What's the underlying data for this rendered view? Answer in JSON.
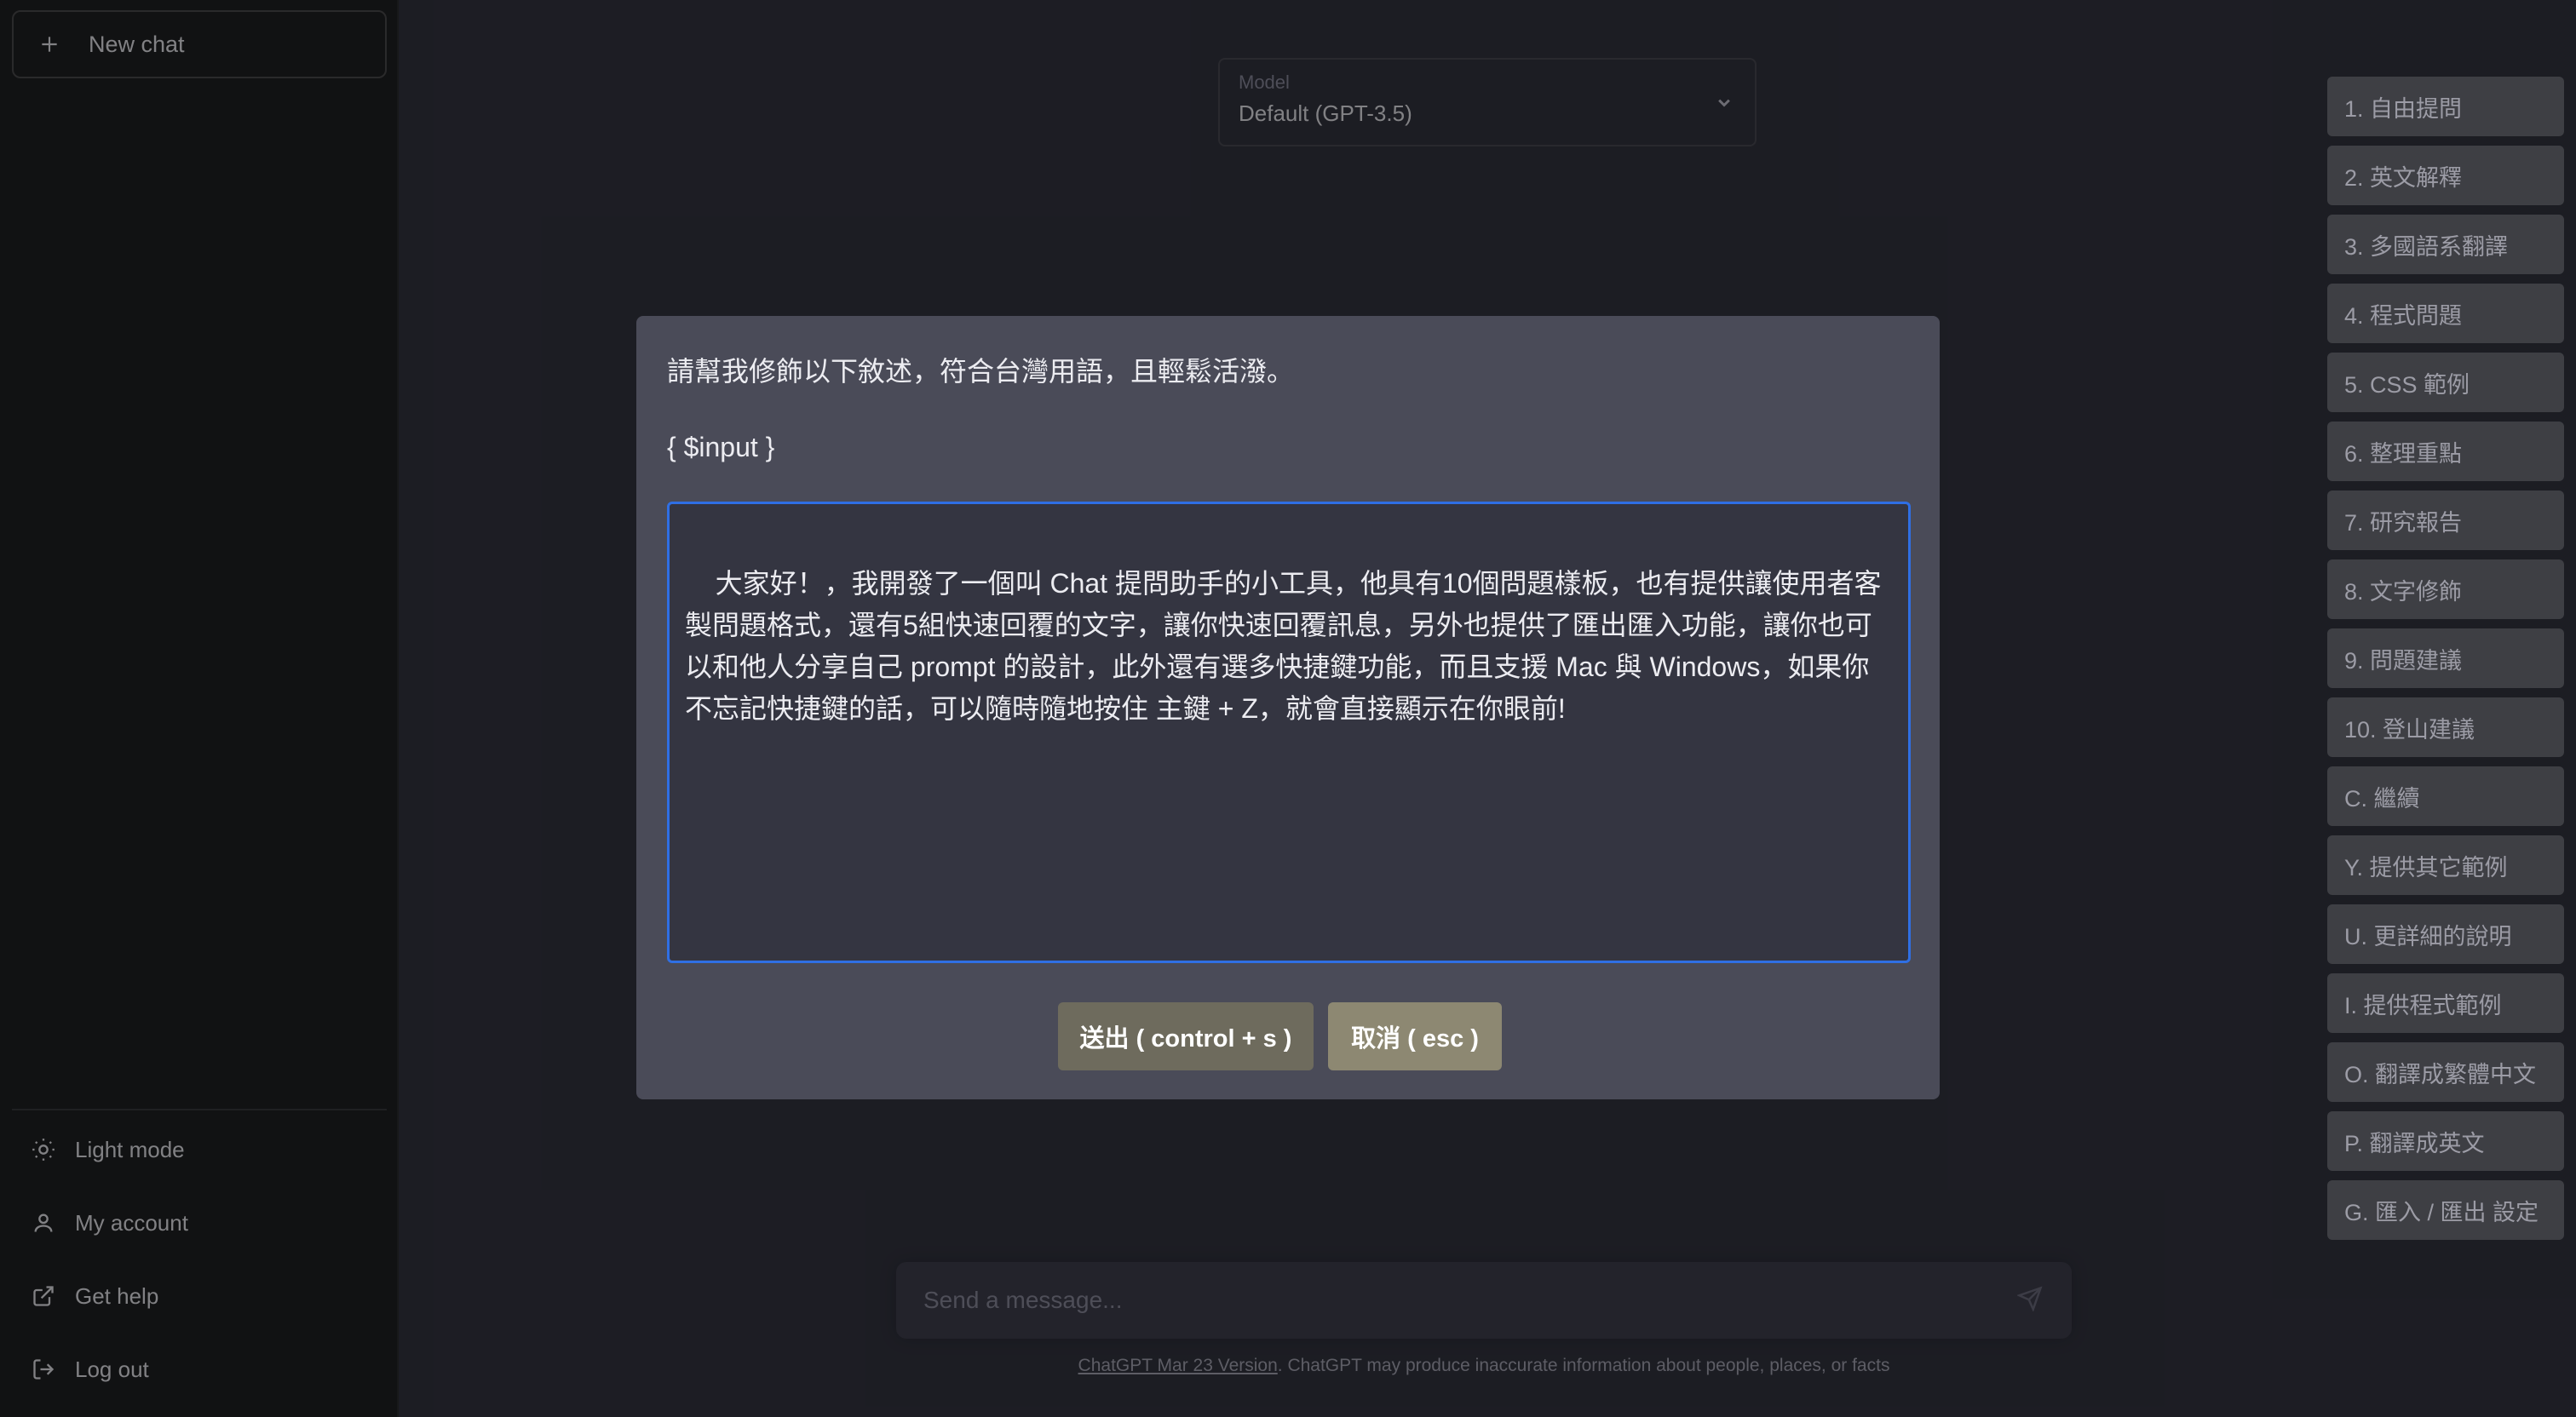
{
  "sidebar": {
    "new_chat_label": "New chat",
    "bottom_items": [
      {
        "label": "Light mode",
        "icon": "sun-icon"
      },
      {
        "label": "My account",
        "icon": "user-icon"
      },
      {
        "label": "Get help",
        "icon": "external-link-icon"
      },
      {
        "label": "Log out",
        "icon": "logout-icon"
      }
    ]
  },
  "model_selector": {
    "label": "Model",
    "value": "Default (GPT-3.5)"
  },
  "composer": {
    "placeholder": "Send a message..."
  },
  "footer": {
    "link_text": "ChatGPT Mar 23 Version",
    "disclaimer": ". ChatGPT may produce inaccurate information about people, places, or facts"
  },
  "template_buttons": [
    "1. 自由提問",
    "2. 英文解釋",
    "3. 多國語系翻譯",
    "4. 程式問題",
    "5. CSS 範例",
    "6. 整理重點",
    "7. 研究報告",
    "8. 文字修飾",
    "9. 問題建議",
    "10. 登山建議",
    "C. 繼續",
    "Y. 提供其它範例",
    "U. 更詳細的說明",
    "I. 提供程式範例",
    "O. 翻譯成繁體中文",
    "P. 翻譯成英文",
    "G. 匯入 / 匯出 設定"
  ],
  "modal": {
    "instruction": "請幫我修飾以下敘述，符合台灣用語，且輕鬆活潑。",
    "input_token": "{ $input }",
    "textarea_value": "大家好！，我開發了一個叫 Chat 提問助手的小工具，他具有10個問題樣板，也有提供讓使用者客製問題格式，還有5組快速回覆的文字，讓你快速回覆訊息，另外也提供了匯出匯入功能，讓你也可以和他人分享自己 prompt 的設計，此外還有選多快捷鍵功能，而且支援 Mac 與 Windows，如果你不忘記快捷鍵的話，可以隨時隨地按住 主鍵 + Z，就會直接顯示在你眼前!",
    "send_label": "送出 ( control + s )",
    "cancel_label": "取消 ( esc )"
  },
  "colors": {
    "sidebar_bg": "#202123",
    "main_bg": "#343541",
    "modal_bg": "#4a4b58",
    "textarea_focus": "#2f6fe4",
    "send_button": "#6e6b5d",
    "cancel_button": "#8d8872"
  }
}
